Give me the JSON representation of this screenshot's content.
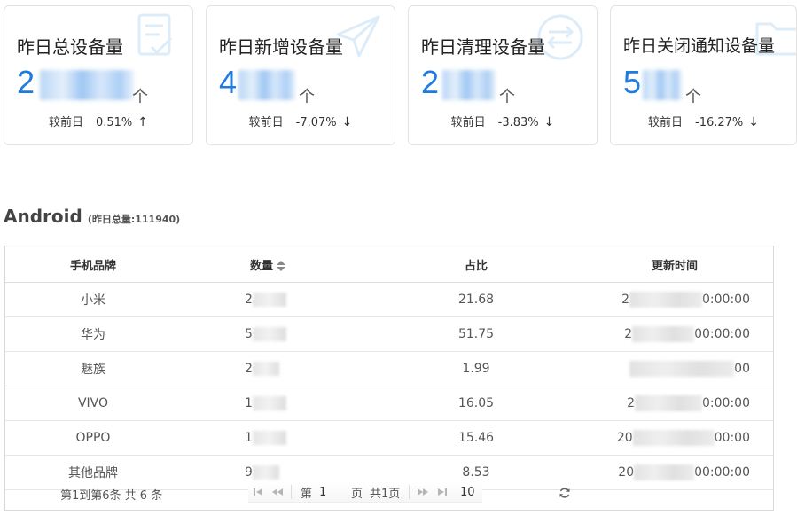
{
  "cards": [
    {
      "title": "昨日总设备量",
      "value_visible": "2",
      "unit": "个",
      "compare_label": "较前日",
      "change": "0.51%",
      "direction": "up",
      "arrow": "↑",
      "icon": "checklist-icon"
    },
    {
      "title": "昨日新增设备量",
      "value_visible": "4",
      "unit": "个",
      "compare_label": "较前日",
      "change": "-7.07%",
      "direction": "down",
      "arrow": "↓",
      "icon": "paper-plane-icon"
    },
    {
      "title": "昨日清理设备量",
      "value_visible": "2",
      "unit": "个",
      "compare_label": "较前日",
      "change": "-3.83%",
      "direction": "down",
      "arrow": "↓",
      "icon": "exchange-icon"
    },
    {
      "title": "昨日关闭通知设备量",
      "value_visible": "5",
      "unit": "个",
      "compare_label": "较前日",
      "change": "-16.27%",
      "direction": "down",
      "arrow": "↓",
      "icon": "folder-icon"
    }
  ],
  "section": {
    "title": "Android",
    "subtitle": "(昨日总量:111940)"
  },
  "table": {
    "columns": [
      "手机品牌",
      "数量",
      "占比",
      "更新时间"
    ],
    "rows": [
      {
        "brand": "小米",
        "count_visible": "2",
        "ratio": "21.68",
        "time_prefix": "2",
        "time_suffix": "0:00:00"
      },
      {
        "brand": "华为",
        "count_visible": "5",
        "ratio": "51.75",
        "time_prefix": "2",
        "time_suffix": "00:00:00"
      },
      {
        "brand": "魅族",
        "count_visible": "2",
        "ratio": "1.99",
        "time_prefix": "",
        "time_suffix": "00"
      },
      {
        "brand": "VIVO",
        "count_visible": "1",
        "ratio": "16.05",
        "time_prefix": "2",
        "time_suffix": "0:00:00"
      },
      {
        "brand": "OPPO",
        "count_visible": "1",
        "ratio": "15.46",
        "time_prefix": "20",
        "time_suffix": "00:00"
      },
      {
        "brand": "其他品牌",
        "count_visible": "9",
        "ratio": "8.53",
        "time_prefix": "20",
        "time_suffix": "00:00:00"
      }
    ]
  },
  "pager": {
    "info": "第1到第6条   共 6 条",
    "page_label": "第",
    "current_page": "1",
    "page_suffix": "页",
    "total_pages": "共1页",
    "page_size": "10"
  },
  "colors": {
    "accent": "#1e7be0",
    "border": "#e3e3e3"
  }
}
